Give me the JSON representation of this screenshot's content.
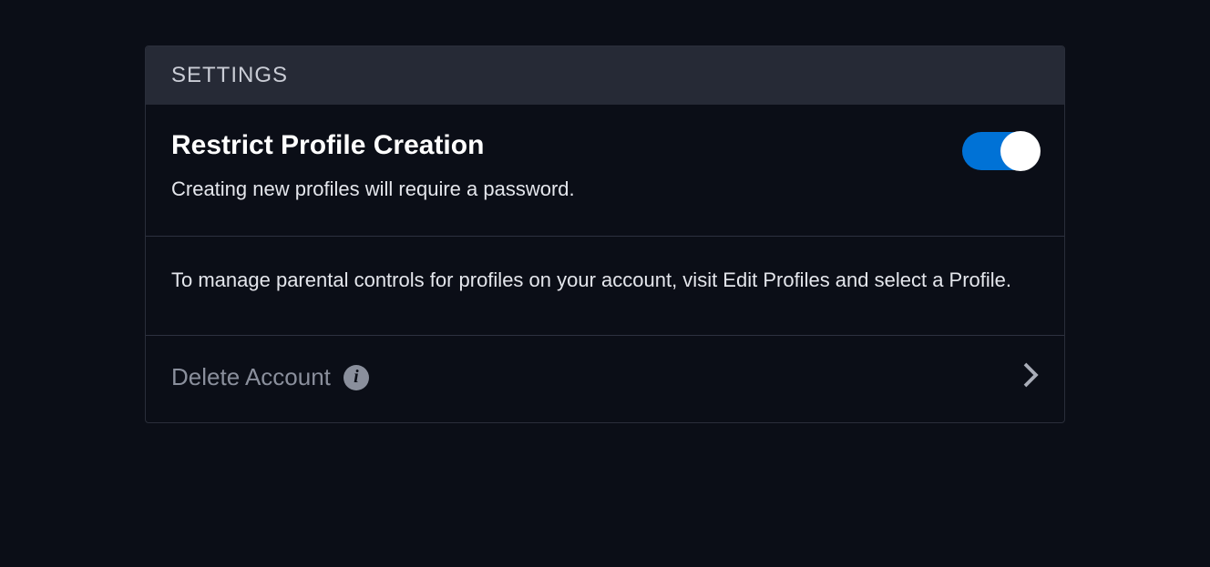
{
  "panel": {
    "header_title": "SETTINGS"
  },
  "restrict_profile": {
    "title": "Restrict Profile Creation",
    "description": "Creating new profiles will require a password.",
    "toggle_on": true
  },
  "parental_info": {
    "text": "To manage parental controls for profiles on your account, visit Edit Profiles and select a Profile."
  },
  "delete_account": {
    "label": "Delete Account"
  }
}
